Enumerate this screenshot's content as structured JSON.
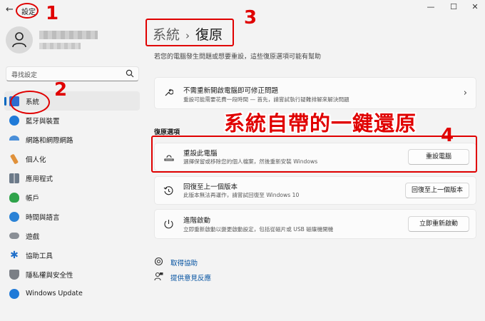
{
  "window": {
    "title": "設定",
    "minimize_glyph": "—",
    "maximize_glyph": "☐",
    "close_glyph": "✕"
  },
  "search": {
    "placeholder": "尋找設定"
  },
  "sidebar": {
    "items": [
      {
        "label": "系統",
        "icon": "system-icon",
        "color": "#2e6ccf",
        "active": true
      },
      {
        "label": "藍牙與裝置",
        "icon": "bluetooth-icon",
        "color": "#1f7ad8"
      },
      {
        "label": "網路和網際網路",
        "icon": "network-icon",
        "color": "#4a8fd9"
      },
      {
        "label": "個人化",
        "icon": "personalization-icon",
        "color": "#e0913a"
      },
      {
        "label": "應用程式",
        "icon": "apps-icon",
        "color": "#6c7a89"
      },
      {
        "label": "帳戶",
        "icon": "accounts-icon",
        "color": "#2fa34a"
      },
      {
        "label": "時間與語言",
        "icon": "time-language-icon",
        "color": "#2a82d6"
      },
      {
        "label": "遊戲",
        "icon": "gaming-icon",
        "color": "#8a8f96"
      },
      {
        "label": "協助工具",
        "icon": "accessibility-icon",
        "color": "#1f6fc9"
      },
      {
        "label": "隱私權與安全性",
        "icon": "privacy-icon",
        "color": "#7b7f86"
      },
      {
        "label": "Windows Update",
        "icon": "windows-update-icon",
        "color": "#1f7ad8"
      }
    ]
  },
  "main": {
    "breadcrumb_parent": "系統",
    "breadcrumb_sep": "›",
    "breadcrumb_current": "復原",
    "description": "若您的電腦發生問題或想要重設，這些復原選項可能有幫助",
    "fix_card": {
      "title": "不需重新開啟電腦即可修正問題",
      "subtitle": "重設可能需要花費一段時間 — 首先，請嘗試執行疑難排解來解決問題"
    },
    "section_heading": "復原選項",
    "options": [
      {
        "title": "重設此電腦",
        "subtitle": "選擇保留或移除您的個人檔案，然後重新安裝 Windows",
        "button": "重設電腦",
        "icon": "reset-pc-icon"
      },
      {
        "title": "回復至上一個版本",
        "subtitle": "此版本無法再運作，請嘗試回復至 Windows 10",
        "button": "回復至上一個版本",
        "icon": "go-back-icon"
      },
      {
        "title": "進階啟動",
        "subtitle": "立即重新啟動以變更啟動設定，包括從磁片或 USB 磁碟機開機",
        "button": "立即重新啟動",
        "icon": "advanced-startup-icon"
      }
    ],
    "links": [
      {
        "label": "取得協助",
        "icon": "help-icon"
      },
      {
        "label": "提供意見反應",
        "icon": "feedback-icon"
      }
    ]
  },
  "annotations": {
    "num1": "1",
    "num2": "2",
    "num3": "3",
    "num4": "4",
    "banner": "系統自帶的一鍵還原",
    "color": "#e00000"
  }
}
